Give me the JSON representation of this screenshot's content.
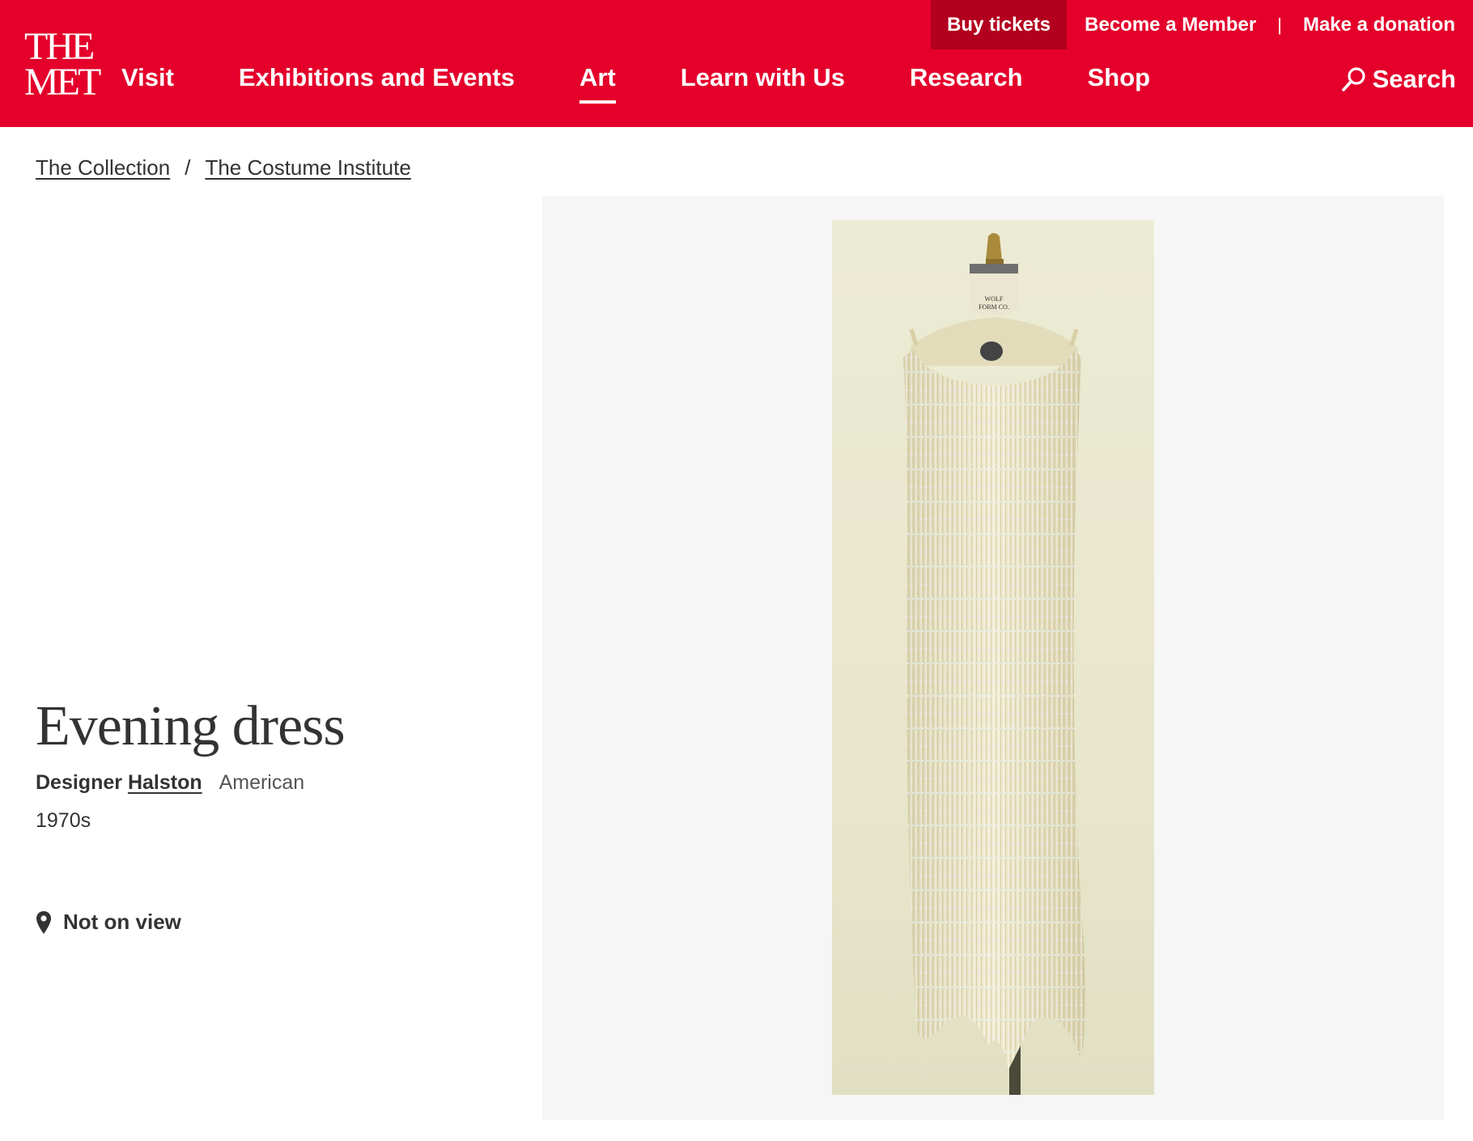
{
  "logo": {
    "line1": "THE",
    "line2": "MET"
  },
  "utility": {
    "buy_tickets": "Buy tickets",
    "become_member": "Become a Member",
    "separator": "|",
    "donation": "Make a donation"
  },
  "nav": {
    "items": [
      {
        "label": "Visit"
      },
      {
        "label": "Exhibitions and Events"
      },
      {
        "label": "Art"
      },
      {
        "label": "Learn with Us"
      },
      {
        "label": "Research"
      },
      {
        "label": "Shop"
      }
    ],
    "active": "Art",
    "search_label": "Search"
  },
  "breadcrumb": {
    "items": [
      "The Collection",
      "The Costume Institute"
    ],
    "separator": "/"
  },
  "object": {
    "title": "Evening dress",
    "designer_role": "Designer",
    "designer_name": "Halston",
    "nationality": "American",
    "date": "1970s",
    "location_status": "Not on view"
  },
  "image": {
    "mannequin_label_line1": "WOLF",
    "mannequin_label_line2": "FORM CO."
  },
  "colors": {
    "brand": "#e4002b",
    "tickets_bg": "#b3001e"
  },
  "icons": [
    "search-icon",
    "location-pin-icon"
  ]
}
